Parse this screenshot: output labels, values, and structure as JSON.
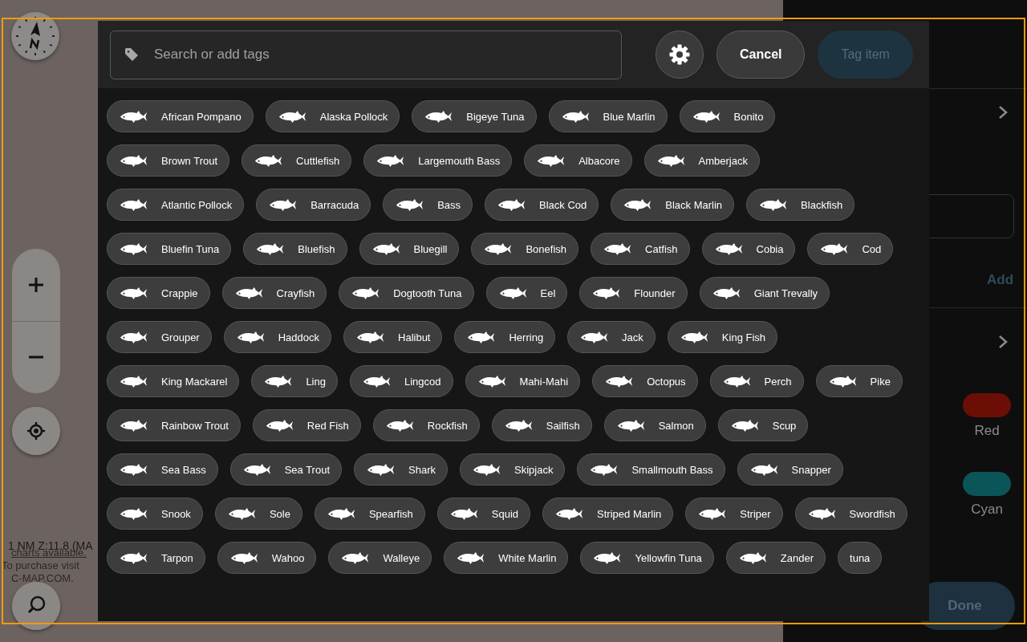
{
  "map": {
    "scale_text": "1 NM Z:11.8 (MA",
    "notice": "charts available.",
    "purchase_lines": [
      "To purchase visit",
      "C-MAP.COM."
    ]
  },
  "side_panel": {
    "add_label": "Add",
    "colors": [
      {
        "label": "Red",
        "color": "#6b0e06"
      },
      {
        "label": "Cyan",
        "color": "#0b5558"
      }
    ],
    "done_button": "Done"
  },
  "tag_dialog": {
    "search": {
      "placeholder": "Search or add tags"
    },
    "buttons": [
      {
        "kind": "settings",
        "disabled": false
      },
      {
        "kind": "text",
        "label": "Cancel",
        "disabled": false
      },
      {
        "kind": "text",
        "label": "Tag item",
        "disabled": true
      }
    ],
    "tags": [
      {
        "label": "African Pompano",
        "icon": true
      },
      {
        "label": "Alaska Pollock",
        "icon": true
      },
      {
        "label": "Bigeye Tuna",
        "icon": true
      },
      {
        "label": "Blue Marlin",
        "icon": true
      },
      {
        "label": "Bonito",
        "icon": true
      },
      {
        "label": "Brown Trout",
        "icon": true
      },
      {
        "label": "Cuttlefish",
        "icon": true
      },
      {
        "label": "Largemouth Bass",
        "icon": true
      },
      {
        "label": "Albacore",
        "icon": true
      },
      {
        "label": "Amberjack",
        "icon": true
      },
      {
        "label": "Atlantic Pollock",
        "icon": true
      },
      {
        "label": "Barracuda",
        "icon": true
      },
      {
        "label": "Bass",
        "icon": true
      },
      {
        "label": "Black Cod",
        "icon": true
      },
      {
        "label": "Black Marlin",
        "icon": true
      },
      {
        "label": "Blackfish",
        "icon": true
      },
      {
        "label": "Bluefin Tuna",
        "icon": true
      },
      {
        "label": "Bluefish",
        "icon": true
      },
      {
        "label": "Bluegill",
        "icon": true
      },
      {
        "label": "Bonefish",
        "icon": true
      },
      {
        "label": "Catfish",
        "icon": true
      },
      {
        "label": "Cobia",
        "icon": true
      },
      {
        "label": "Cod",
        "icon": true
      },
      {
        "label": "Crappie",
        "icon": true
      },
      {
        "label": "Crayfish",
        "icon": true
      },
      {
        "label": "Dogtooth Tuna",
        "icon": true
      },
      {
        "label": "Eel",
        "icon": true
      },
      {
        "label": "Flounder",
        "icon": true
      },
      {
        "label": "Giant Trevally",
        "icon": true
      },
      {
        "label": "Grouper",
        "icon": true
      },
      {
        "label": "Haddock",
        "icon": true
      },
      {
        "label": "Halibut",
        "icon": true
      },
      {
        "label": "Herring",
        "icon": true
      },
      {
        "label": "Jack",
        "icon": true
      },
      {
        "label": "King Fish",
        "icon": true
      },
      {
        "label": "King Mackarel",
        "icon": true
      },
      {
        "label": "Ling",
        "icon": true
      },
      {
        "label": "Lingcod",
        "icon": true
      },
      {
        "label": "Mahi-Mahi",
        "icon": true
      },
      {
        "label": "Octopus",
        "icon": true
      },
      {
        "label": "Perch",
        "icon": true
      },
      {
        "label": "Pike",
        "icon": true
      },
      {
        "label": "Rainbow Trout",
        "icon": true
      },
      {
        "label": "Red Fish",
        "icon": true
      },
      {
        "label": "Rockfish",
        "icon": true
      },
      {
        "label": "Sailfish",
        "icon": true
      },
      {
        "label": "Salmon",
        "icon": true
      },
      {
        "label": "Scup",
        "icon": true
      },
      {
        "label": "Sea Bass",
        "icon": true
      },
      {
        "label": "Sea Trout",
        "icon": true
      },
      {
        "label": "Shark",
        "icon": true
      },
      {
        "label": "Skipjack",
        "icon": true
      },
      {
        "label": "Smallmouth Bass",
        "icon": true
      },
      {
        "label": "Snapper",
        "icon": true
      },
      {
        "label": "Snook",
        "icon": true
      },
      {
        "label": "Sole",
        "icon": true
      },
      {
        "label": "Spearfish",
        "icon": true
      },
      {
        "label": "Squid",
        "icon": true
      },
      {
        "label": "Striped Marlin",
        "icon": true
      },
      {
        "label": "Striper",
        "icon": true
      },
      {
        "label": "Swordfish",
        "icon": true
      },
      {
        "label": "Tarpon",
        "icon": true
      },
      {
        "label": "Wahoo",
        "icon": true
      },
      {
        "label": "Walleye",
        "icon": true
      },
      {
        "label": "White Marlin",
        "icon": true
      },
      {
        "label": "Yellowfin Tuna",
        "icon": true
      },
      {
        "label": "Zander",
        "icon": true
      },
      {
        "label": "tuna",
        "icon": false
      }
    ]
  }
}
